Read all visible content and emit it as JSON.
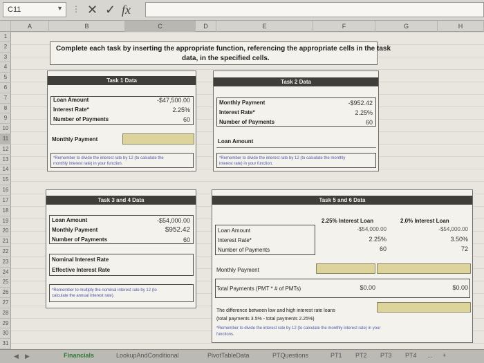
{
  "formula_bar": {
    "name_box": "C11",
    "cancel": "✕",
    "confirm": "✓",
    "function": "fx",
    "content": ""
  },
  "columns": [
    "A",
    "B",
    "C",
    "D",
    "E",
    "F",
    "G",
    "H"
  ],
  "rows": [
    "1",
    "2",
    "3",
    "4",
    "5",
    "6",
    "7",
    "8",
    "9",
    "10",
    "11",
    "12",
    "13",
    "14",
    "15",
    "16",
    "17",
    "18",
    "19",
    "20",
    "21",
    "22",
    "23",
    "24",
    "25",
    "26",
    "27",
    "28",
    "29",
    "30",
    "31"
  ],
  "instructions": {
    "line1": "Complete each task by inserting the appropriate function, referencing the appropriate cells in the task",
    "line2": "data, in the specified cells."
  },
  "task1": {
    "title": "Task 1 Data",
    "loan_amount_label": "Loan Amount",
    "loan_amount": "-$47,500.00",
    "rate_label": "Interest Rate*",
    "rate": "2.25%",
    "payments_label": "Number of Payments",
    "payments": "60",
    "result_label": "Monthly Payment",
    "note1": "*Remember to divide the interest rate by 12 (to calculate the",
    "note2": "monthly interest rate) in your function."
  },
  "task2": {
    "title": "Task 2 Data",
    "payment_label": "Monthly Payment",
    "payment": "-$952.42",
    "rate_label": "Interest Rate*",
    "rate": "2.25%",
    "payments_label": "Number of Payments",
    "payments": "60",
    "result_label": "Loan Amount",
    "note1": "*Remember to divide the interest rate by 12 (to calculate the monthly",
    "note2": "interest rate) in your function."
  },
  "task34": {
    "title": "Task 3 and 4 Data",
    "loan_amount_label": "Loan Amount",
    "loan_amount": "-$54,000.00",
    "payment_label": "Monthly Payment",
    "payment": "$952.42",
    "payments_label": "Number of Payments",
    "payments": "60",
    "nominal_label": "Nominal Interest Rate",
    "effective_label": "Effective Interest Rate",
    "note1": "*Remember to multiply the nominal interest rate by 12 (to",
    "note2": "calculate the annual interest rate)."
  },
  "task56": {
    "title": "Task 5 and 6 Data",
    "col1_header": "2.25% Interest Loan",
    "col2_header": "2.0% Interest Loan",
    "loan_amount_label": "Loan Amount",
    "loan1": "-$54,000.00",
    "loan2": "-$54,000.00",
    "rate_label": "Interest Rate*",
    "rate1": "2.25%",
    "rate2": "3.50%",
    "payments_label": "Number of Payments",
    "payments1": "60",
    "payments2": "72",
    "payment_label": "Monthly Payment",
    "total_label": "Total Payments (PMT * # of PMTs)",
    "total1": "$0.00",
    "total2": "$0.00",
    "diff_line1": "The difference between low and high interest rate loans",
    "diff_line2": "(total payments 3.5% - total payments 2.25%)",
    "note1": "*Remember to divide the interest rate by 12 (to calculate the monthly interest rate) in your",
    "note2": "functions."
  },
  "tabs": [
    "Financials",
    "LookupAndConditional",
    "PivotTableData",
    "PTQuestions",
    "PT1",
    "PT2",
    "PT3",
    "PT4"
  ],
  "tab_more": "...",
  "tab_add": "+"
}
